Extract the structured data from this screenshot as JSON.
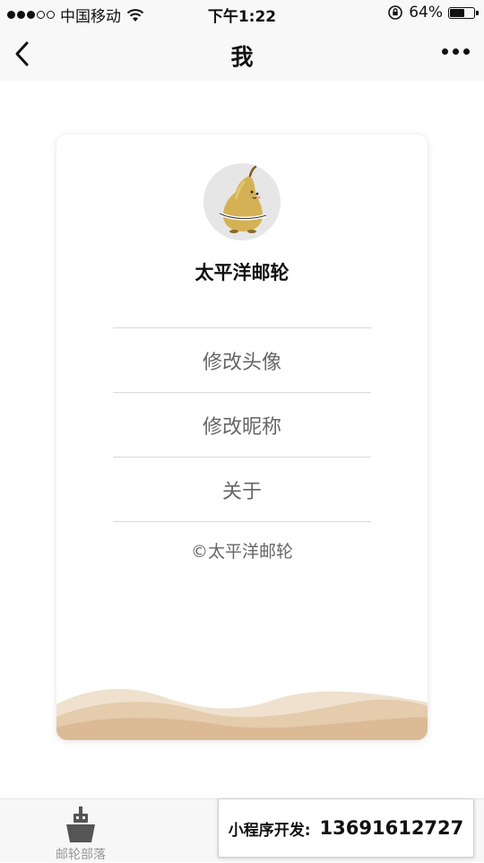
{
  "status_bar": {
    "carrier": "中国移动",
    "time": "下午1:22",
    "battery_percent": "64%",
    "battery_level": 0.64,
    "icons": [
      "signal-dots-icon",
      "wifi-icon",
      "rotation-lock-icon",
      "battery-icon"
    ]
  },
  "nav": {
    "title": "我",
    "back_icon": "chevron-left-icon",
    "more_icon": "more-dots-icon"
  },
  "profile": {
    "name": "太平洋邮轮",
    "avatar_icon": "pear-avatar-icon"
  },
  "menu": {
    "items": [
      {
        "label": "修改头像"
      },
      {
        "label": "修改昵称"
      },
      {
        "label": "关于"
      }
    ]
  },
  "footer": {
    "copyright": "©太平洋邮轮"
  },
  "tab_bar": {
    "tabs": [
      {
        "label": "邮轮部落",
        "icon": "ship-icon"
      }
    ]
  },
  "promo": {
    "label": "小程序开发:",
    "phone": "13691612727"
  },
  "colors": {
    "wave_light": "#ecdcc6",
    "wave_dark": "#d9b892",
    "card_bg": "#ffffff",
    "menu_text": "#666666"
  }
}
